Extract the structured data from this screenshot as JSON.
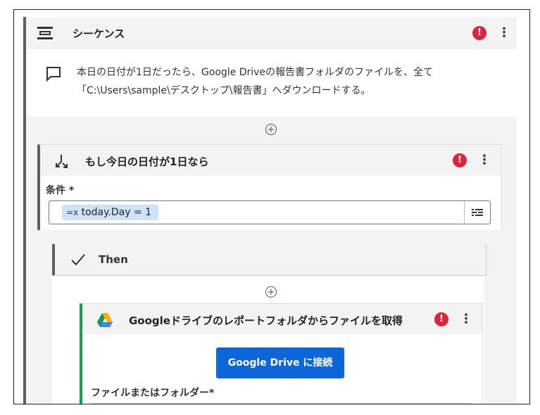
{
  "sequence": {
    "title": "シーケンス",
    "comment_line1": "本日の日付が1日だったら、Google Driveの報告書フォルダのファイルを、全て",
    "comment_line2": "「C:\\Users\\sample\\デスクトップ\\報告書」へダウンロードする。"
  },
  "if_block": {
    "title": "もし今日の日付が1日なら",
    "condition_label": "条件 *",
    "condition_value": "today.Day = 1"
  },
  "then_block": {
    "label": "Then"
  },
  "google_block": {
    "title": "Googleドライブのレポートフォルダからファイルを取得",
    "connect_label": "Google Drive に接続",
    "file_label": "ファイルまたはフォルダー*"
  },
  "icons": {
    "sequence": "sequence-icon",
    "comment": "comment-icon",
    "if": "branch-icon",
    "then": "check-icon",
    "google": "google-drive-icon",
    "error": "error-icon",
    "more": "more-vertical-icon",
    "add": "add-circle-icon",
    "expression": "expression-icon",
    "variable_picker": "variable-picker-icon",
    "folder": "folder-icon"
  },
  "colors": {
    "error": "#d7263d",
    "primary_button": "#0c66d8",
    "google_accent": "#1e9e4a",
    "chip_bg": "#cfe3f8"
  }
}
